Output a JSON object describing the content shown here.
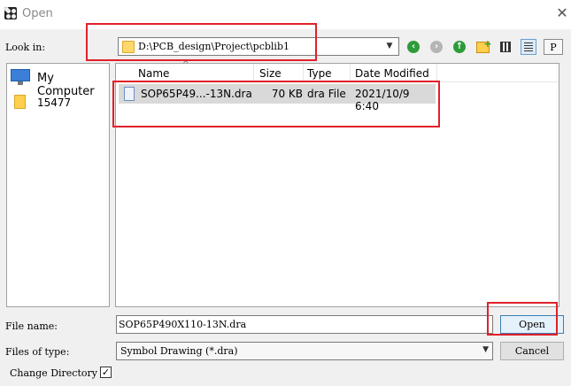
{
  "window": {
    "title": "Open"
  },
  "look_in": {
    "label": "Look in:",
    "path": "D:\\PCB_design\\Project\\pcblib1"
  },
  "toolbar": {
    "icons": [
      "back-icon",
      "forward-icon",
      "up-folder-icon",
      "new-folder-icon",
      "list-view-icon",
      "details-view-icon",
      "preview-icon"
    ],
    "preview_label": "P"
  },
  "places": [
    {
      "label": "My Computer",
      "icon": "computer-icon"
    },
    {
      "label": "15477",
      "icon": "folder-icon"
    }
  ],
  "columns": [
    "Name",
    "Size",
    "Type",
    "Date Modified"
  ],
  "files": [
    {
      "name": "SOP65P49...-13N.dra",
      "size": "70 KB",
      "type": "dra File",
      "date": "2021/10/9 6:40"
    }
  ],
  "file_name": {
    "label": "File name:",
    "value": "SOP65P490X110-13N.dra"
  },
  "files_of_type": {
    "label": "Files of type:",
    "value": "Symbol Drawing (*.dra)"
  },
  "buttons": {
    "open": "Open",
    "cancel": "Cancel"
  },
  "change_directory": {
    "label": "Change Directory",
    "checked": true,
    "check_glyph": "✓"
  },
  "colors": {
    "annotation": "#e0202a",
    "selection": "#d9d9d9",
    "accent": "#3c7fb1"
  }
}
